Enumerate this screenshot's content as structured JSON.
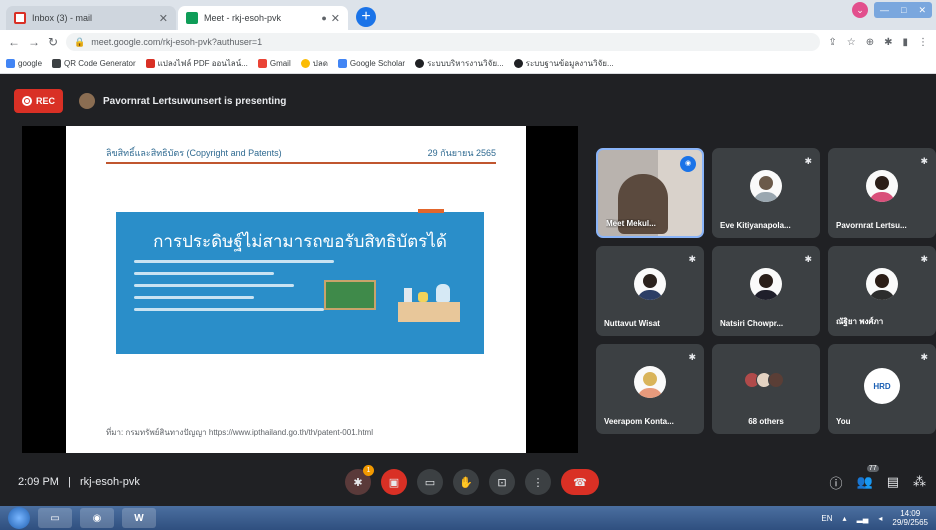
{
  "browser": {
    "tabs": [
      {
        "label": "Inbox (3) - mail",
        "favicon": "gmail-icon",
        "active": false
      },
      {
        "label": "Meet - rkj-esoh-pvk",
        "favicon": "meet-icon",
        "active": true
      }
    ],
    "new_tab": "+",
    "url": "meet.google.com/rkj-esoh-pvk?authuser=1",
    "bookmarks": [
      {
        "label": "google",
        "color": "#4285f4"
      },
      {
        "label": "QR Code Generator",
        "color": "#3c4043"
      },
      {
        "label": "แปลงไฟล์ PDF ออนไลน์...",
        "color": "#d93025"
      },
      {
        "label": "Gmail",
        "color": "#ea4335"
      },
      {
        "label": "ปลด",
        "color": "#fbbc04"
      },
      {
        "label": "Google Scholar",
        "color": "#4285f4"
      },
      {
        "label": "ระบบบริหารงานวิจัย...",
        "color": "#202124"
      },
      {
        "label": "ระบบฐานข้อมูลงานวิจัย...",
        "color": "#202124"
      }
    ]
  },
  "meet": {
    "rec_label": "REC",
    "presenting_text": "Pavornrat Lertsuwunsert is presenting",
    "slide": {
      "header_title": "ลิขสิทธิ์และสิทธิบัตร (Copyright and Patents)",
      "header_date": "29 กันยายน 2565",
      "main_title": "การประดิษฐ์ไม่สามารถขอรับสิทธิบัตรได้",
      "footer": "ที่มา: กรมทรัพย์สินทางปัญญา https://www.ipthailand.go.th/th/patent-001.html"
    },
    "participants": [
      {
        "name": "Meet Mekul...",
        "type": "video"
      },
      {
        "name": "Eve Kitiyanapola...",
        "type": "avatar",
        "head": "#6b5a4a",
        "body": "#9aa7b0"
      },
      {
        "name": "Pavornrat Lertsu...",
        "type": "avatar",
        "head": "#2b1e18",
        "body": "#d94f7a"
      },
      {
        "name": "Nuttavut Wisat",
        "type": "avatar",
        "head": "#2a211c",
        "body": "#2c3e66"
      },
      {
        "name": "Natsiri Chowpr...",
        "type": "avatar",
        "head": "#2a1f1a",
        "body": "#1f1f2b"
      },
      {
        "name": "ณัฐิยา พงศ์ภา",
        "type": "avatar",
        "head": "#2b1d16",
        "body": "#2d2d2d"
      },
      {
        "name": "Veerapom Konta...",
        "type": "avatar",
        "head": "#d9b45a",
        "body": "#e79a7c"
      },
      {
        "name": "68 others",
        "type": "group"
      },
      {
        "name": "You",
        "type": "you",
        "logo": "HRD"
      }
    ],
    "time": "2:09 PM",
    "meeting_code": "rkj-esoh-pvk",
    "separator": "|",
    "raise_hand_badge": "1",
    "participants_count": "77",
    "taskbar": {
      "lang": "EN",
      "clock_time": "14:09",
      "clock_date": "29/9/2565"
    }
  }
}
